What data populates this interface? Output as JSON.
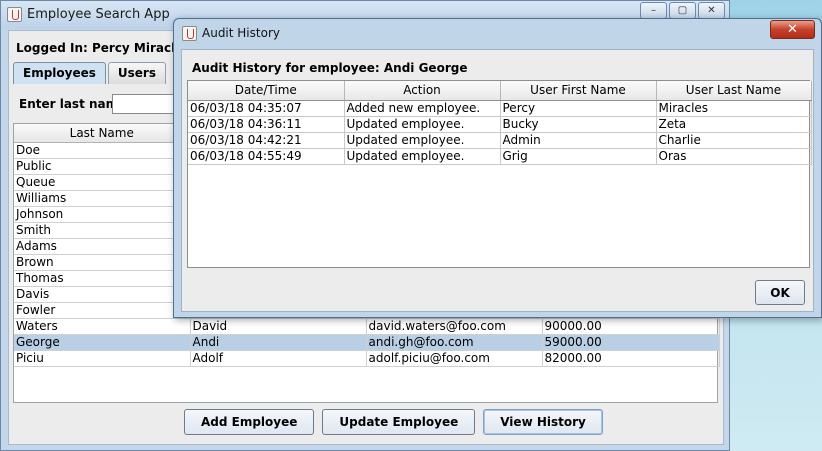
{
  "main_window": {
    "title": "Employee Search App",
    "controls": [
      "–",
      "▢",
      "✕"
    ],
    "logged_in": "Logged In: Percy Miracles",
    "tabs": [
      "Employees",
      "Users"
    ],
    "search_label": "Enter last name",
    "search_value": "",
    "table": {
      "headers": [
        "Last Name",
        "",
        "",
        ""
      ],
      "rows": [
        [
          "Doe",
          "",
          "",
          ""
        ],
        [
          "Public",
          "",
          "",
          ""
        ],
        [
          "Queue",
          "",
          "",
          ""
        ],
        [
          "Williams",
          "",
          "",
          ""
        ],
        [
          "Johnson",
          "",
          "",
          ""
        ],
        [
          "Smith",
          "",
          "",
          ""
        ],
        [
          "Adams",
          "",
          "",
          ""
        ],
        [
          "Brown",
          "",
          "",
          ""
        ],
        [
          "Thomas",
          "",
          "",
          ""
        ],
        [
          "Davis",
          "",
          "",
          ""
        ],
        [
          "Fowler",
          "",
          "",
          ""
        ],
        [
          "Waters",
          "David",
          "david.waters@foo.com",
          "90000.00"
        ],
        [
          "George",
          "Andi",
          "andi.gh@foo.com",
          "59000.00"
        ],
        [
          "Piciu",
          "Adolf",
          "adolf.piciu@foo.com",
          "82000.00"
        ]
      ],
      "selected_row_index": 12
    },
    "buttons": {
      "add": "Add Employee",
      "update": "Update Employee",
      "history": "View History"
    }
  },
  "dialog": {
    "title": "Audit History",
    "close": "✕",
    "heading": "Audit History for employee:  Andi George",
    "table": {
      "headers": [
        "Date/Time",
        "Action",
        "User First Name",
        "User Last Name"
      ],
      "rows": [
        [
          "06/03/18 04:35:07",
          "Added new employee.",
          "Percy",
          "Miracles"
        ],
        [
          "06/03/18 04:36:11",
          "Updated employee.",
          "Bucky",
          "Zeta"
        ],
        [
          "06/03/18 04:42:21",
          "Updated employee.",
          "Admin",
          "Charlie"
        ],
        [
          "06/03/18 04:55:49",
          "Updated employee.",
          "Grig",
          "Oras"
        ]
      ]
    },
    "ok_label": "OK"
  }
}
